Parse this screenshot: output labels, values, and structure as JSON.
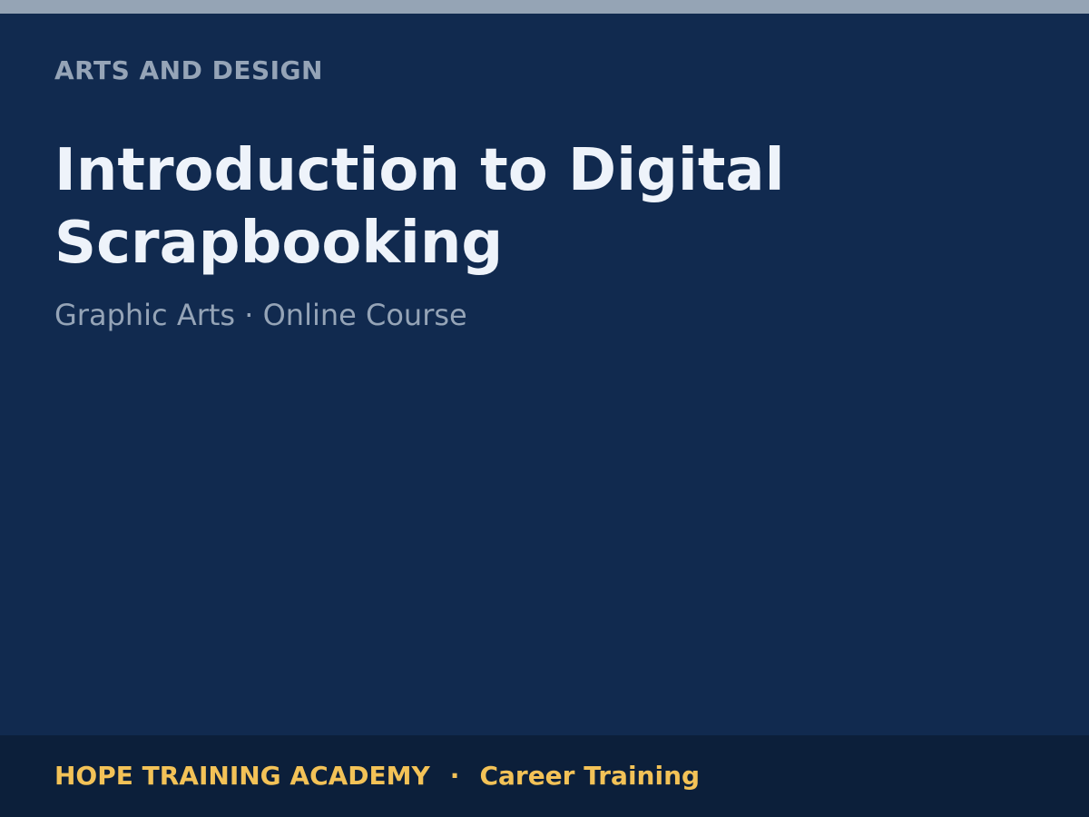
{
  "header": {
    "category": "ARTS AND DESIGN"
  },
  "course": {
    "title": "Introduction to Digital Scrapbooking",
    "subtitle": "Graphic Arts · Online Course"
  },
  "footer": {
    "organization": "HOPE TRAINING ACADEMY",
    "separator": "·",
    "tagline": "Career Training"
  },
  "colors": {
    "background": "#112a4f",
    "top_strip": "#95a4b5",
    "footer_background": "#0c1f3a",
    "accent": "#f3c257",
    "title_text": "#eef3fa",
    "muted_text": "#95a4b7"
  }
}
